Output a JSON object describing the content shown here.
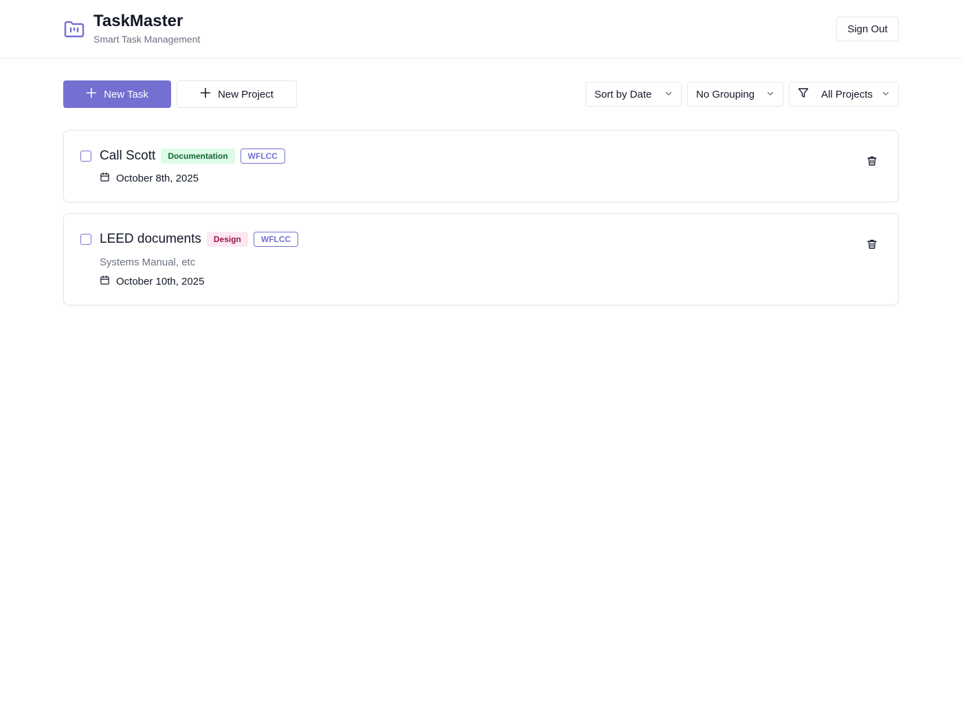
{
  "app": {
    "title": "TaskMaster",
    "subtitle": "Smart Task Management",
    "logo_icon": "folder-kanban-icon",
    "accent_color": "#7470d2"
  },
  "header": {
    "sign_out_label": "Sign Out"
  },
  "toolbar": {
    "new_task_label": "New Task",
    "new_project_label": "New Project",
    "sort": {
      "selected": "Sort by Date"
    },
    "grouping": {
      "selected": "No Grouping"
    },
    "project_filter": {
      "selected": "All Projects"
    }
  },
  "tasks": [
    {
      "title": "Call Scott",
      "category": "Documentation",
      "category_color": "#166534",
      "project": "WFLCC",
      "description": "",
      "date": "October 8th, 2025",
      "completed": false
    },
    {
      "title": "LEED documents",
      "category": "Design",
      "category_color": "#9d174d",
      "project": "WFLCC",
      "description": "Systems Manual, etc",
      "date": "October 10th, 2025",
      "completed": false
    }
  ]
}
